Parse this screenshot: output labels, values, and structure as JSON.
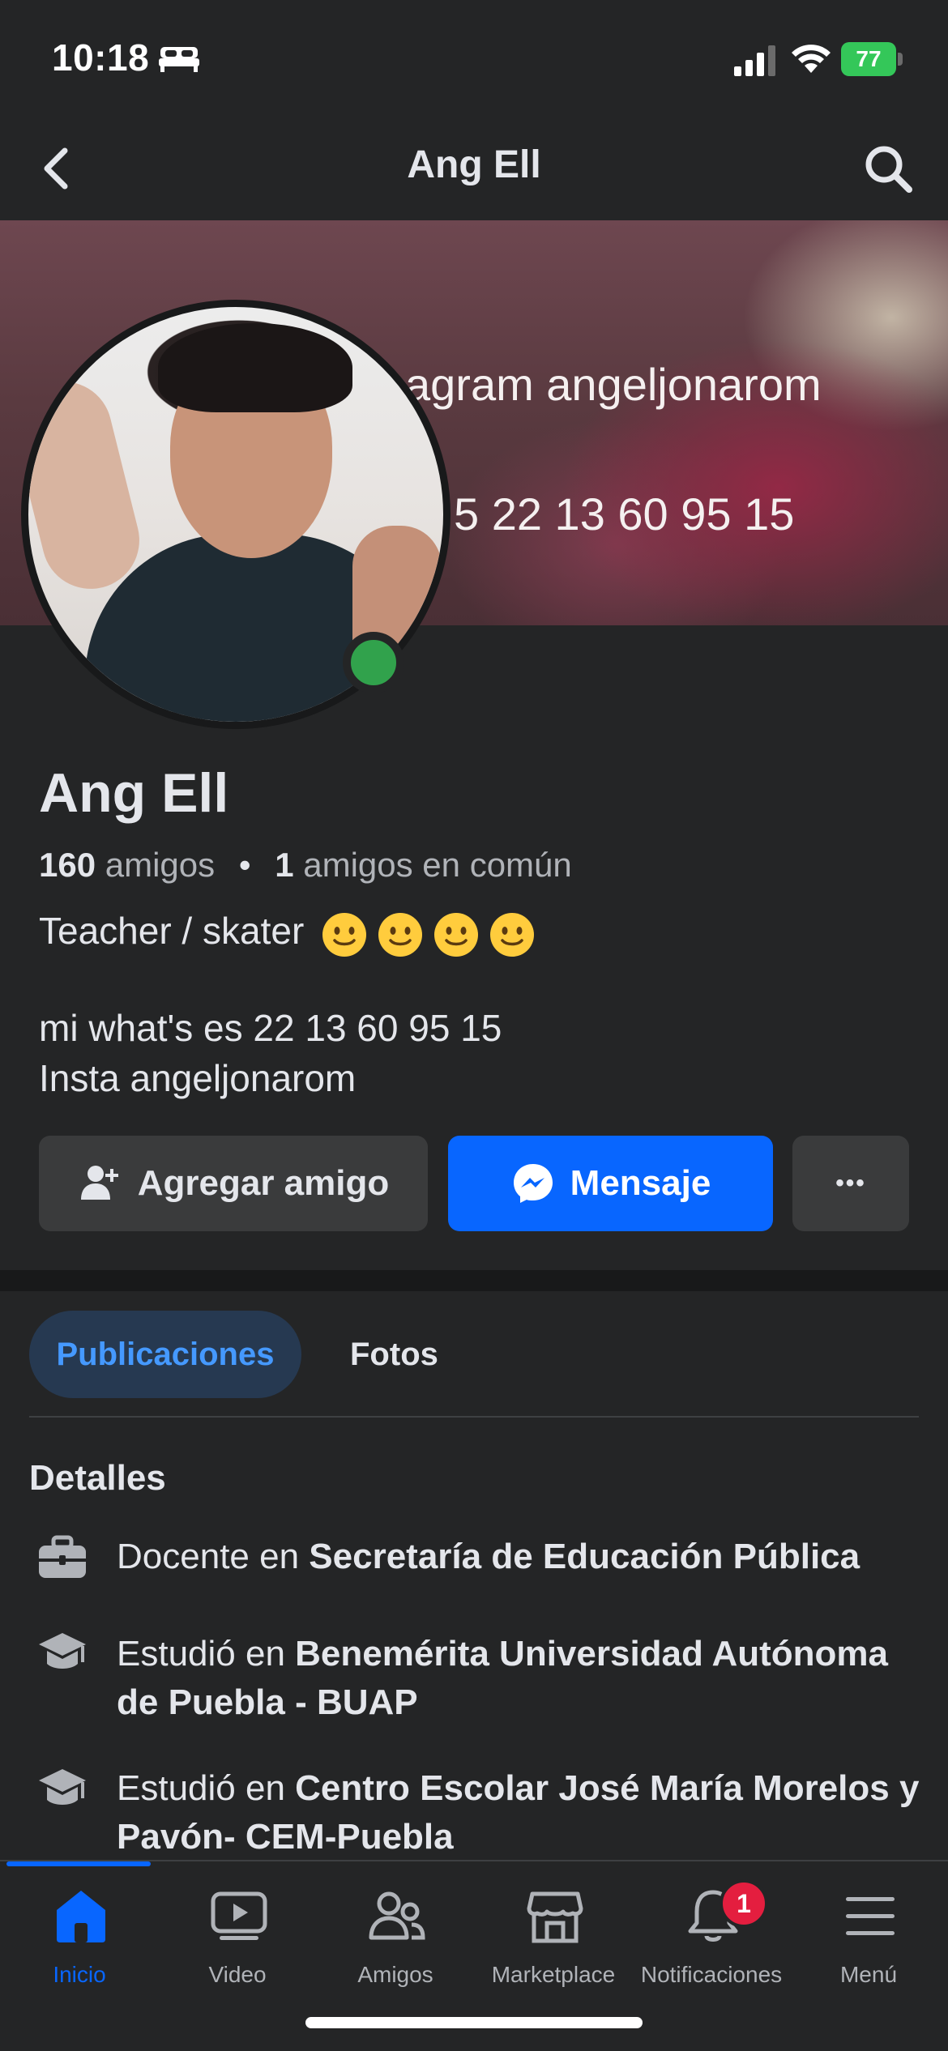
{
  "status_bar": {
    "time": "10:18",
    "battery": "77",
    "icons": [
      "bed-icon",
      "signal-icon",
      "wifi-icon",
      "battery-charging-icon"
    ]
  },
  "header": {
    "title": "Ang Ell",
    "back_icon": "chevron-left-icon",
    "search_icon": "search-icon"
  },
  "cover": {
    "line1": "agram angeljonarom",
    "line2": "5 22 13 60 95 15"
  },
  "profile": {
    "name": "Ang Ell",
    "friends_count": "160",
    "friends_label": "amigos",
    "mutual_count": "1",
    "mutual_label": "amigos en común",
    "separator": "•",
    "bio_line1": "Teacher / skater",
    "bio_emojis": [
      "slightly-smiling-face",
      "slightly-smiling-face",
      "slightly-smiling-face",
      "slightly-smiling-face"
    ],
    "bio_line2": "mi what's es 22 13 60 95 15",
    "bio_line3": "Insta angeljonarom",
    "online": true
  },
  "actions": {
    "add_friend": "Agregar amigo",
    "message": "Mensaje",
    "more": "•••"
  },
  "tabs": [
    {
      "label": "Publicaciones",
      "active": true
    },
    {
      "label": "Fotos",
      "active": false
    }
  ],
  "details": {
    "title": "Detalles",
    "items": [
      {
        "icon": "briefcase-icon",
        "prefix": "Docente en ",
        "bold": "Secretaría de Educación Pública"
      },
      {
        "icon": "graduation-cap-icon",
        "prefix": "Estudió en ",
        "bold": "Benemérita Universidad Autónoma de Puebla - BUAP"
      },
      {
        "icon": "graduation-cap-icon",
        "prefix": "Estudió en ",
        "bold": "Centro Escolar José María Morelos y Pavón- CEM-Puebla"
      }
    ]
  },
  "bottom_nav": {
    "items": [
      {
        "label": "Inicio",
        "icon": "home-icon",
        "active": true
      },
      {
        "label": "Video",
        "icon": "video-icon",
        "active": false
      },
      {
        "label": "Amigos",
        "icon": "friends-icon",
        "active": false
      },
      {
        "label": "Marketplace",
        "icon": "marketplace-icon",
        "active": false
      },
      {
        "label": "Notificaciones",
        "icon": "bell-icon",
        "active": false,
        "badge": "1"
      },
      {
        "label": "Menú",
        "icon": "menu-icon",
        "active": false
      }
    ]
  },
  "colors": {
    "background": "#242526",
    "accent": "#0866ff",
    "active_tab_bg": "#263951",
    "active_tab_text": "#4599ff",
    "online": "#31a24c",
    "badge": "#e41e3f"
  }
}
